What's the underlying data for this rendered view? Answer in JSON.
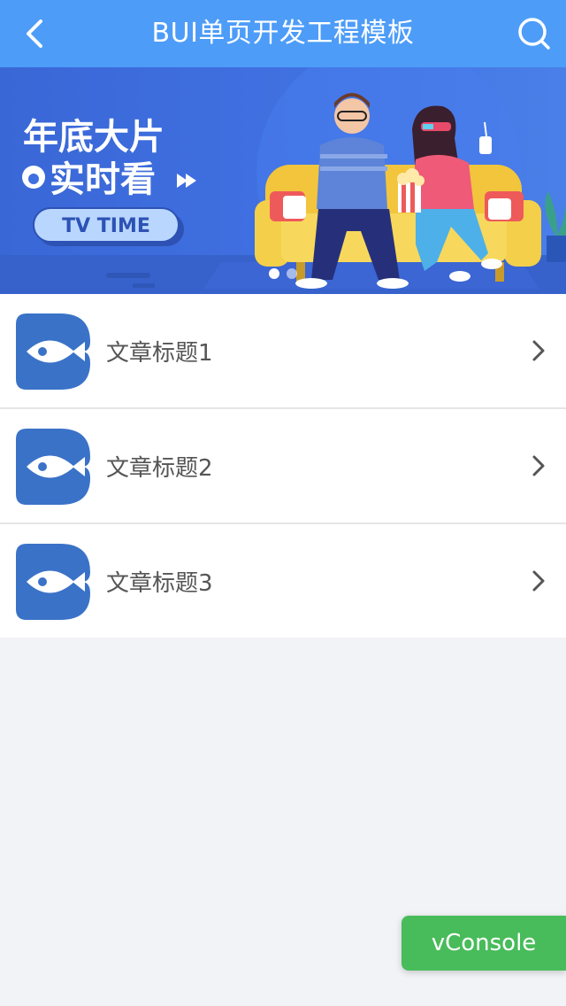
{
  "header": {
    "title": "BUI单页开发工程模板",
    "back_icon": "chevron-left-icon",
    "search_icon": "search-icon"
  },
  "banner": {
    "headline_line1": "年底大片",
    "headline_line2": "实时看",
    "badge": "TV TIME",
    "slide_count": 2,
    "active_slide": 1
  },
  "articles": [
    {
      "title": "文章标题1",
      "icon": "fish-logo-icon"
    },
    {
      "title": "文章标题2",
      "icon": "fish-logo-icon"
    },
    {
      "title": "文章标题3",
      "icon": "fish-logo-icon"
    }
  ],
  "floating": {
    "vconsole_label": "vConsole"
  },
  "colors": {
    "header_bg": "#4d9cf8",
    "banner_bg": "#3f6fe0",
    "page_bg": "#f2f3f7",
    "thumb_bg": "#3a72c8",
    "vconsole_bg": "#48bc5a"
  }
}
